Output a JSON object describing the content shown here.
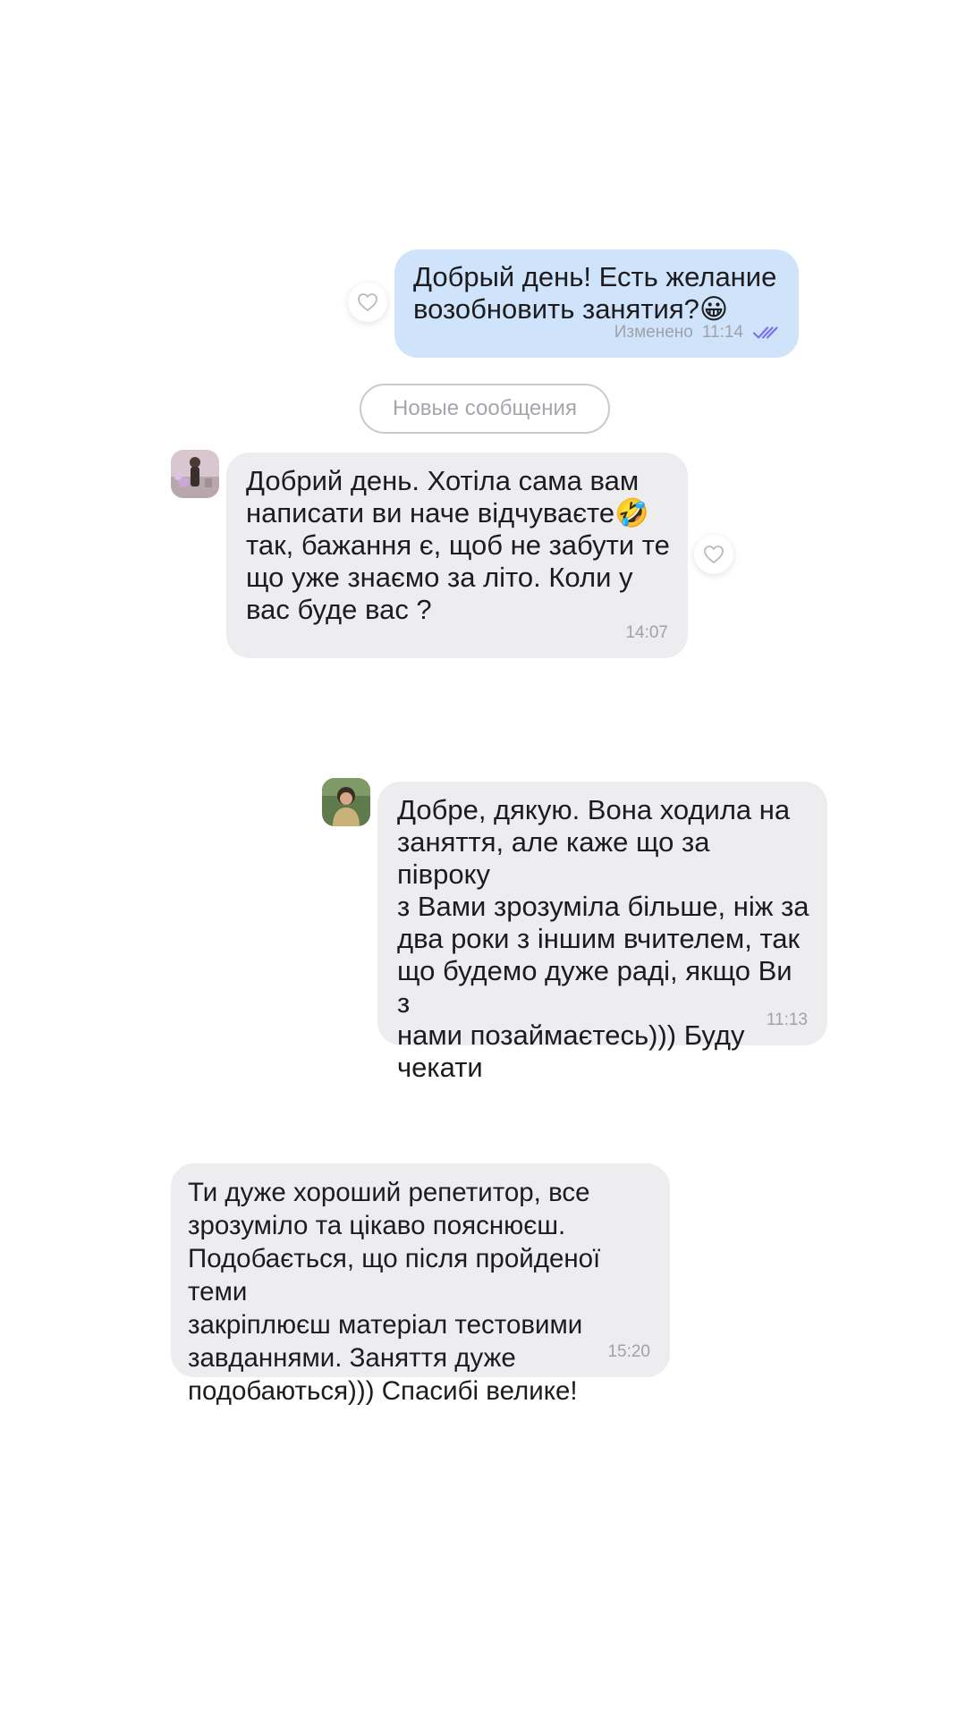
{
  "divider": {
    "label": "Новые сообщения"
  },
  "messages": [
    {
      "direction": "outgoing",
      "text": "Добрый день! Есть желание\nвозобновить занятия?😀",
      "edited_label": "Изменено",
      "time": "11:14",
      "status_icon": "double-check-icon",
      "liked": false
    },
    {
      "direction": "incoming",
      "text": "Добрий день. Хотіла сама вам\nнаписати ви наче відчуваєте🤣\nтак, бажання є, щоб не забути те\nщо уже знаємо за літо. Коли у\nвас буде вас ?",
      "time": "14:07",
      "liked": false
    },
    {
      "direction": "incoming",
      "text": "Добре, дякую. Вона ходила на\nзаняття, але каже що за півроку\nз Вами зрозуміла більше, ніж за\nдва роки з іншим вчителем, так\nщо будемо дуже раді, якщо Ви з\nнами позаймаєтесь))) Буду\nчекати",
      "time": "11:13"
    },
    {
      "direction": "incoming",
      "text": "Ти дуже хороший репетитор, все\nзрозуміло та цікаво пояснюєш.\nПодобається, що після пройденої теми\nзакріплюєш матеріал тестовими\nзавданнями. Заняття дуже\nподобаються))) Спасибі велике!",
      "time": "15:20"
    }
  ],
  "colors": {
    "outgoing_bubble": "#cfe3fb",
    "incoming_bubble": "#ededf0",
    "read_check": "#7b6ff0",
    "meta_text": "#a1a1a8"
  }
}
